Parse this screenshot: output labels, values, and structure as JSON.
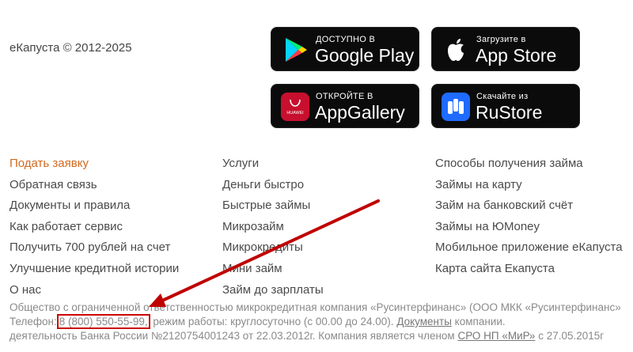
{
  "footer": {
    "copyright": "еКапуста © 2012-2025"
  },
  "badges": [
    {
      "small": "ДОСТУПНО В",
      "big": "Google Play",
      "icon": "google-play-icon"
    },
    {
      "small": "Загрузите в",
      "big": "App Store",
      "icon": "apple-icon"
    },
    {
      "small": "ОТКРОЙТЕ В",
      "big": "AppGallery",
      "icon": "huawei-icon",
      "icon_text": "HUAWEI"
    },
    {
      "small": "Скачайте из",
      "big": "RuStore",
      "icon": "rustore-icon"
    }
  ],
  "links": {
    "col1": [
      "Подать заявку",
      "Обратная связь",
      "Документы и правила",
      "Как работает сервис",
      "Получить 700 рублей на счет",
      "Улучшение кредитной истории",
      "О нас"
    ],
    "col2": [
      "Услуги",
      "Деньги быстро",
      "Быстрые займы",
      "Микрозайм",
      "Микрокредиты",
      "Мини займ",
      "Займ до зарплаты"
    ],
    "col3": [
      "Способы получения займа",
      "Займы на карту",
      "Займ на банковский счёт",
      "Займы на ЮMoney",
      "Мобильное приложение еКапуста",
      "Карта сайта Екапуста"
    ]
  },
  "legal": {
    "line1": "Общество с ограниченной ответственностью микрокредитная компания «Русинтерфинанс» (ООО МКК «Русинтерфинанс»",
    "line2_prefix": "Телефон:",
    "phone": "8 (800) 550-55-99,",
    "line2_mid": "режим работы: круглосуточно (с 00.00 до 24.00).",
    "documents_link": "Документы",
    "line2_suffix": "компании.",
    "line3_prefix": "деятельность Банка России №2120754001243 от 22.03.2012г. Компания является членом",
    "sro_link": "СРО НП «МиР»",
    "line3_suffix": "с 27.05.2015г"
  },
  "colors": {
    "accent": "#d2691e",
    "annotation": "#cc0000"
  }
}
